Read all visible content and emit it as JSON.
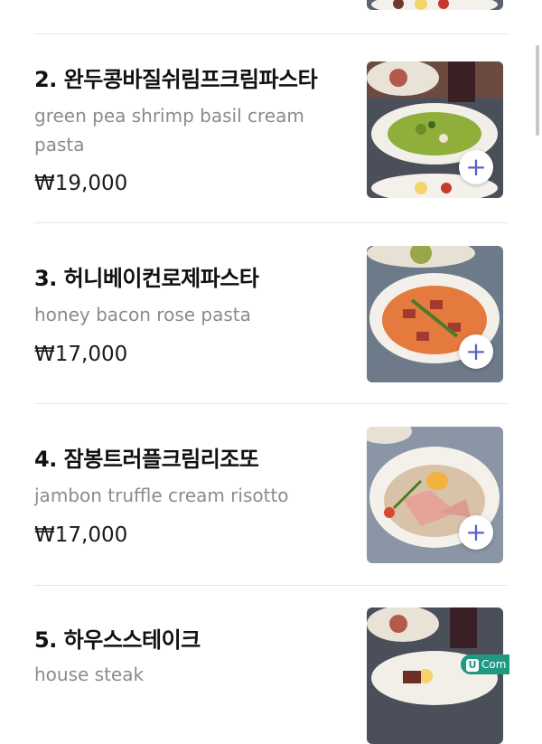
{
  "menu": {
    "items": [
      {
        "title": "2. 완두콩바질쉬림프크림파스타",
        "description": "green pea shrimp basil cream pasta",
        "price": "₩19,000",
        "add_label": "+"
      },
      {
        "title": "3. 허니베이컨로제파스타",
        "description": "honey bacon rose pasta",
        "price": "₩17,000",
        "add_label": "+"
      },
      {
        "title": "4. 잠봉트러플크림리조또",
        "description": "jambon truffle cream risotto",
        "price": "₩17,000",
        "add_label": "+"
      },
      {
        "title": "5. 하우스스테이크",
        "description": "house steak",
        "price": "",
        "add_label": "+"
      }
    ]
  },
  "badge": {
    "logo": "U",
    "text": "Com"
  },
  "colors": {
    "accent": "#5a63c8",
    "badge": "#1e9a82"
  }
}
